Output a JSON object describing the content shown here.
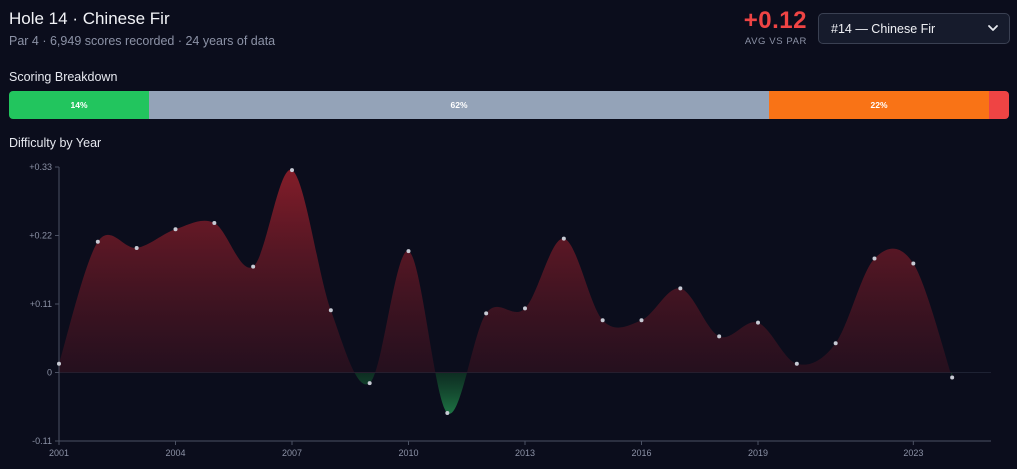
{
  "header": {
    "title": "Hole 14 · Chinese Fir",
    "subtitle": "Par 4 · 6,949 scores recorded · 24 years of data",
    "stat_value": "+0.12",
    "stat_label": "AVG VS PAR"
  },
  "hole_select": {
    "value": "#14 — Chinese Fir",
    "icon": "chevron-down-icon"
  },
  "sections": {
    "breakdown_title": "Scoring Breakdown",
    "difficulty_title": "Difficulty by Year"
  },
  "breakdown": [
    {
      "label": "14%",
      "value": 14,
      "color": "#22c55e"
    },
    {
      "label": "62%",
      "value": 62,
      "color": "#94a3b8"
    },
    {
      "label": "22%",
      "value": 22,
      "color": "#f97316"
    },
    {
      "label": "",
      "value": 2,
      "color": "#ef4444"
    }
  ],
  "chart_data": {
    "type": "area",
    "title": "Difficulty by Year",
    "x": [
      2001,
      2002,
      2003,
      2004,
      2005,
      2006,
      2007,
      2008,
      2009,
      2010,
      2011,
      2012,
      2013,
      2014,
      2015,
      2016,
      2017,
      2018,
      2019,
      2020,
      2021,
      2022,
      2023,
      2024,
      2025
    ],
    "values": [
      0.014,
      0.21,
      0.2,
      0.23,
      0.24,
      0.17,
      0.325,
      0.1,
      -0.017,
      0.195,
      -0.065,
      0.095,
      0.103,
      0.215,
      0.084,
      0.084,
      0.135,
      0.058,
      0.08,
      0.014,
      0.047,
      0.183,
      0.175,
      -0.008,
      null
    ],
    "ylim": [
      -0.11,
      0.33
    ],
    "yticks": [
      -0.11,
      0,
      0.11,
      0.22,
      0.33
    ],
    "ytick_labels": [
      "-0.11",
      "0",
      "+0.11",
      "+0.22",
      "+0.33"
    ],
    "xticks": [
      2001,
      2004,
      2007,
      2010,
      2013,
      2016,
      2019,
      2023
    ],
    "xtick_labels": [
      "2001",
      "2004",
      "2007",
      "2010",
      "2013",
      "2016",
      "2019",
      "2023"
    ],
    "colors": {
      "positive": "#ef4444",
      "negative": "#22c55e",
      "point": "#c7cad4",
      "axis": "#4b5163"
    }
  }
}
